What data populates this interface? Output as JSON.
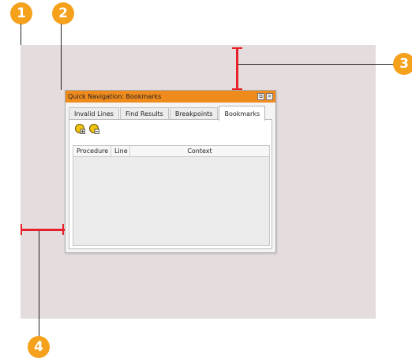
{
  "callouts": [
    "1",
    "2",
    "3",
    "4"
  ],
  "dialog": {
    "title": "Quick Navigation: Bookmarks",
    "title_bar_color": "#ef8a1c",
    "restore_glyph": "⧉",
    "close_glyph": "✕",
    "tabs": [
      "Invalid Lines",
      "Find Results",
      "Breakpoints",
      "Bookmarks"
    ],
    "active_tab": "Bookmarks",
    "toolbar": [
      "add-bookmark-icon",
      "remove-bookmark-icon"
    ],
    "columns": [
      "Procedure",
      "Line",
      "Context"
    ]
  },
  "colors": {
    "callout": "#f5a11c",
    "dimension": "#e8202a",
    "canvas": "#e4dcdd"
  }
}
